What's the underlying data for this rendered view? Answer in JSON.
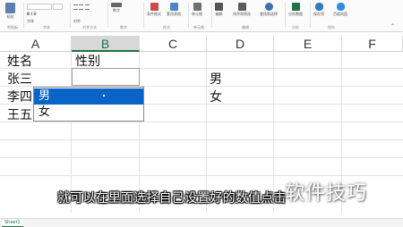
{
  "ribbon": {
    "groups": [
      {
        "label": "粘贴",
        "color": "#5b7fb1"
      },
      {
        "label": "字体",
        "color": "#888888"
      },
      {
        "label": "对齐",
        "color": "#777777"
      },
      {
        "label": "数字",
        "color": "#666666"
      },
      {
        "label": "条件格式",
        "color": "#c94c4c"
      },
      {
        "label": "套用表格",
        "color": "#4a86c5"
      },
      {
        "label": "单元格",
        "color": "#707070"
      },
      {
        "label": "编辑",
        "color": "#555555"
      },
      {
        "label": "排序和筛选",
        "color": "#5a5a5a"
      },
      {
        "label": "查找和选择",
        "color": "#3e6fb0"
      },
      {
        "label": "分析数据",
        "color": "#217346"
      },
      {
        "label": "保存到",
        "color": "#3579c4"
      },
      {
        "label": "百度网盘",
        "color": "#2a8fe0"
      }
    ],
    "group_titles": [
      "剪贴板",
      "字体",
      "对齐方式",
      "数字",
      "样式",
      "单元格",
      "编辑",
      "分析",
      "保存"
    ]
  },
  "columns": [
    "A",
    "B",
    "C",
    "D",
    "E",
    "F"
  ],
  "selected_column": "B",
  "cells": {
    "a1": "姓名",
    "b1": "性别",
    "a2": "张三",
    "a3": "李四",
    "a4": "王五",
    "d2": "男",
    "d3": "女"
  },
  "dropdown": {
    "options": [
      "男",
      "女"
    ],
    "highlighted": "男"
  },
  "caption": "就可以在里面选择自己设置好的数值点击",
  "watermark": "软件技巧",
  "sheet_tab": "Sheet1",
  "colors": {
    "excel_green": "#1e7145",
    "highlight_blue": "#0a64c8"
  }
}
